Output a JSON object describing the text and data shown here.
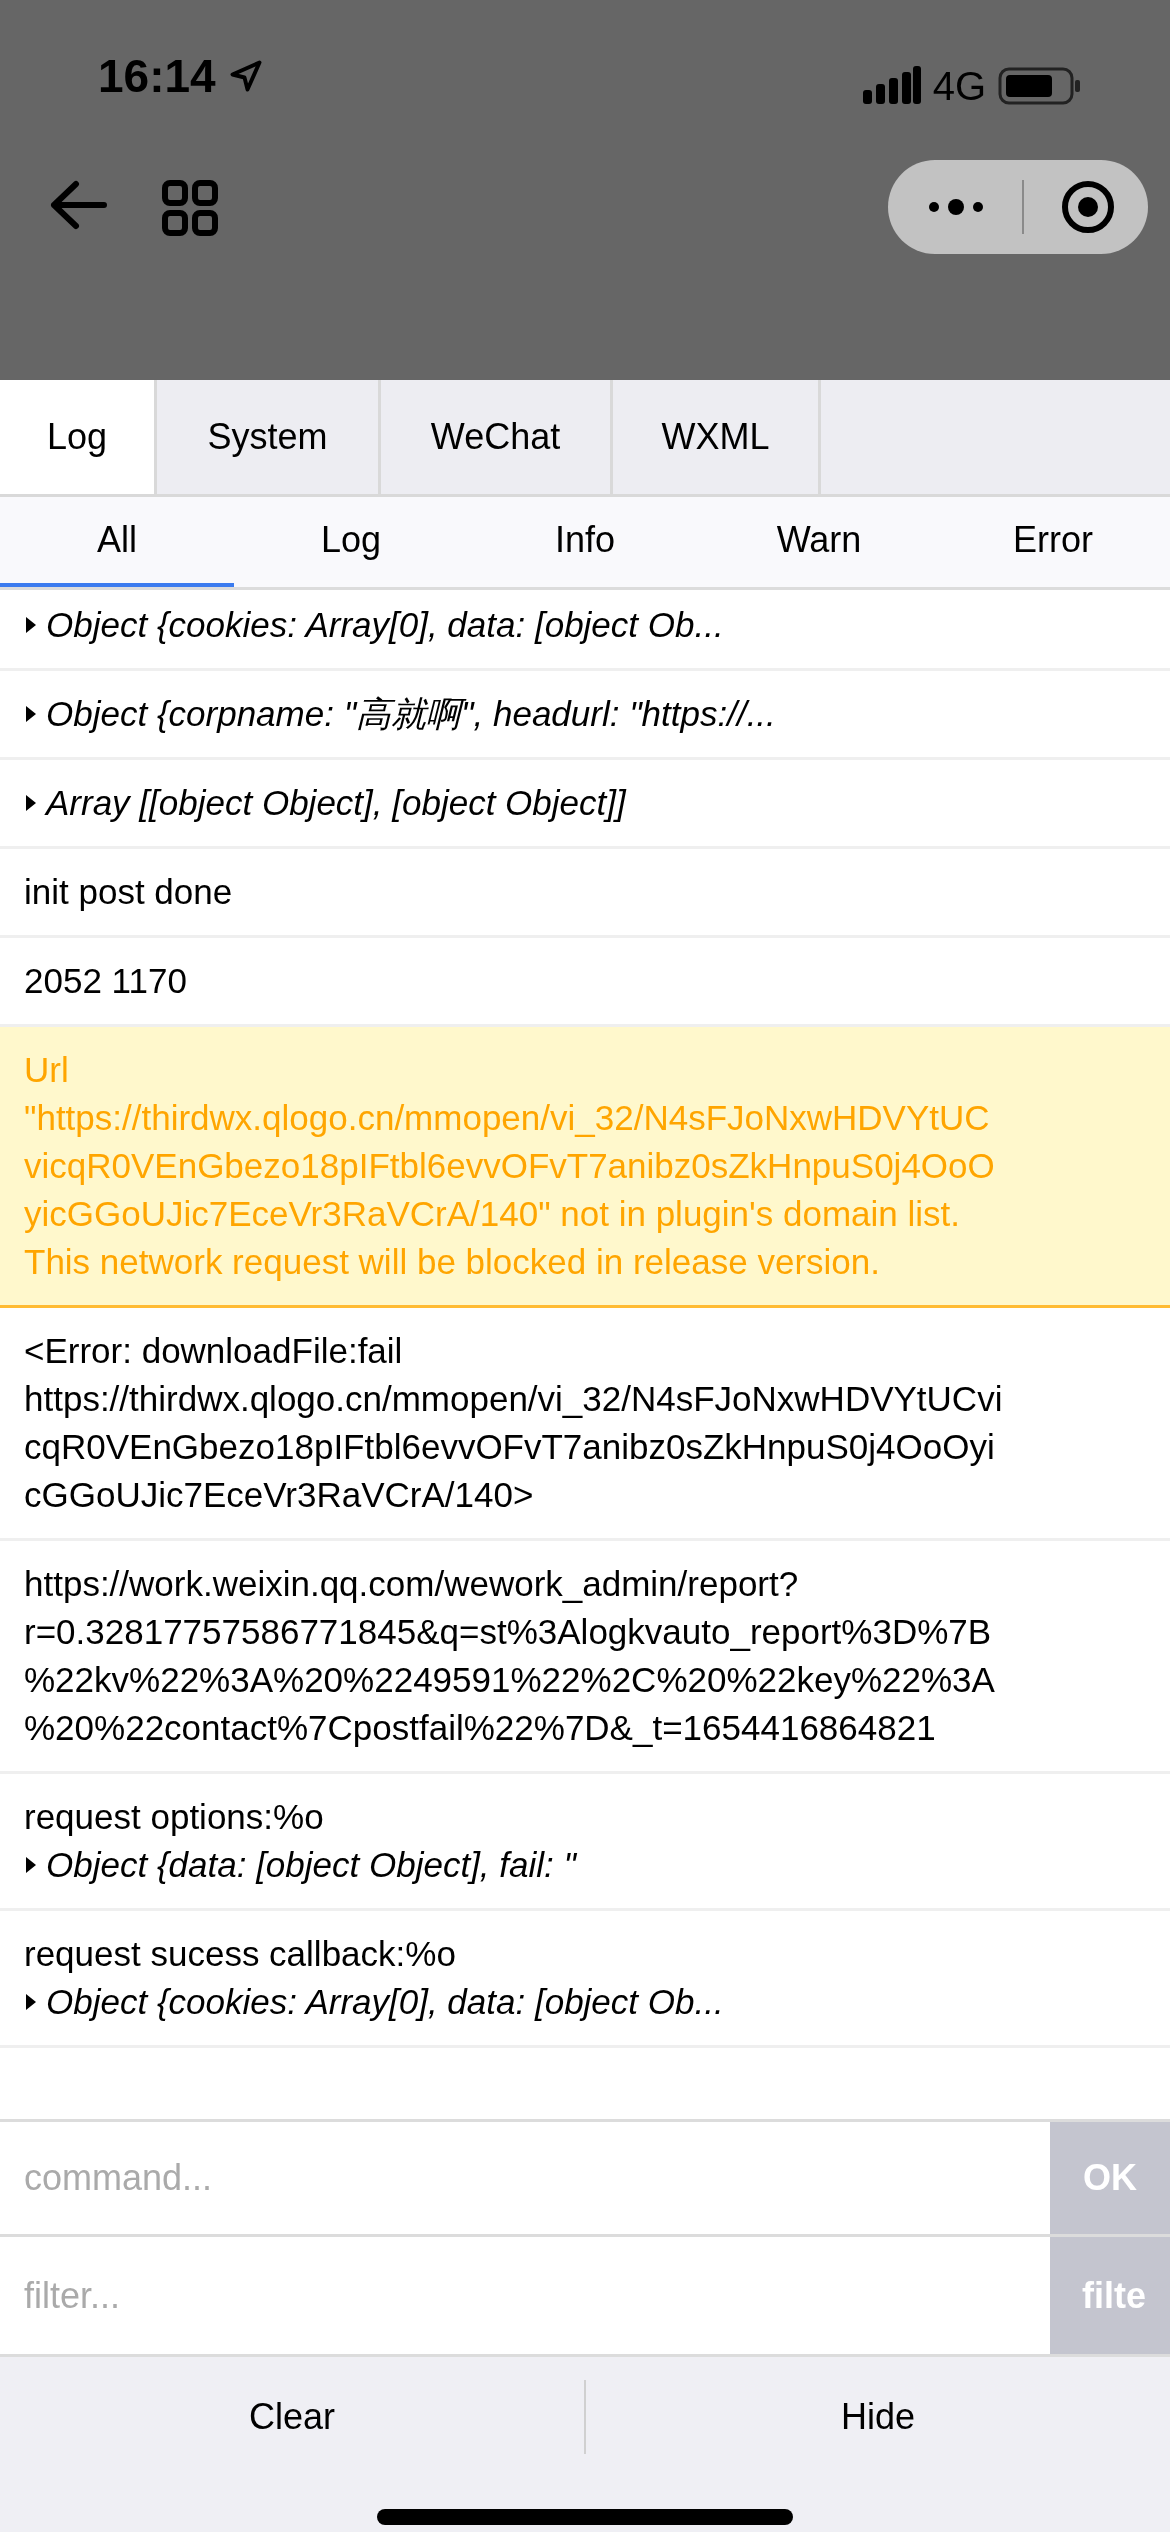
{
  "status_bar": {
    "time": "16:14",
    "network": "4G"
  },
  "tabs": [
    {
      "label": "Log",
      "selected": true
    },
    {
      "label": "System",
      "selected": false
    },
    {
      "label": "WeChat",
      "selected": false
    },
    {
      "label": "WXML",
      "selected": false
    }
  ],
  "filters": [
    {
      "label": "All",
      "selected": true
    },
    {
      "label": "Log",
      "selected": false
    },
    {
      "label": "Info",
      "selected": false
    },
    {
      "label": "Warn",
      "selected": false
    },
    {
      "label": "Error",
      "selected": false
    }
  ],
  "log_rows": [
    {
      "kind": "message",
      "lines": [
        {
          "kind": "object",
          "text": "Object {cookies: Array[0], data: [object Ob..."
        }
      ]
    },
    {
      "kind": "message",
      "lines": [
        {
          "kind": "object",
          "text": "Object {corpname: \"高就啊\", headurl: \"https://..."
        }
      ]
    },
    {
      "kind": "message",
      "lines": [
        {
          "kind": "object",
          "text": "Array [[object Object], [object Object]]"
        }
      ]
    },
    {
      "kind": "message",
      "lines": [
        {
          "kind": "text",
          "text": "init post done"
        }
      ]
    },
    {
      "kind": "message",
      "lines": [
        {
          "kind": "text",
          "text": "2052 1170"
        }
      ]
    },
    {
      "kind": "warning",
      "lines": [
        {
          "kind": "text",
          "text": "Url \"https://thirdwx.qlogo.cn/mmopen/vi_32/N4sFJoNxwHDVYtUCvicqR0VEnGbezo18pIFtbl6evvOFvT7anibz0sZkHnpuS0j4OoOyicGGoUJic7EceVr3RaVCrA/140\" not in plugin's domain list. This network request will be blocked in release version."
        }
      ]
    },
    {
      "kind": "message",
      "lines": [
        {
          "kind": "text",
          "text": "<Error: downloadFile:fail https://thirdwx.qlogo.cn/mmopen/vi_32/N4sFJoNxwHDVYtUCvicqR0VEnGbezo18pIFtbl6evvOFvT7anibz0sZkHnpuS0j4OoOyicGGoUJic7EceVr3RaVCrA/140>"
        }
      ]
    },
    {
      "kind": "message",
      "lines": [
        {
          "kind": "text",
          "text": "https://work.weixin.qq.com/wework_admin/report?r=0.32817757586771845&q=st%3Alogkvauto_report%3D%7B%22kv%22%3A%20%2249591%22%2C%20%22key%22%3A%20%22contact%7Cpostfail%22%7D&_t=1654416864821"
        }
      ]
    },
    {
      "kind": "message",
      "lines": [
        {
          "kind": "text",
          "text": "request options:%o"
        },
        {
          "kind": "object",
          "text": "Object {data: [object Object], fail: \""
        }
      ]
    },
    {
      "kind": "message",
      "lines": [
        {
          "kind": "text",
          "text": "request sucess callback:%o"
        },
        {
          "kind": "object",
          "text": "Object {cookies: Array[0], data: [object Ob..."
        }
      ]
    }
  ],
  "command": {
    "placeholder": "command...",
    "button": "OK"
  },
  "filter": {
    "placeholder": "filter...",
    "button": "filte"
  },
  "bottom_buttons": [
    "Clear",
    "Hide"
  ]
}
